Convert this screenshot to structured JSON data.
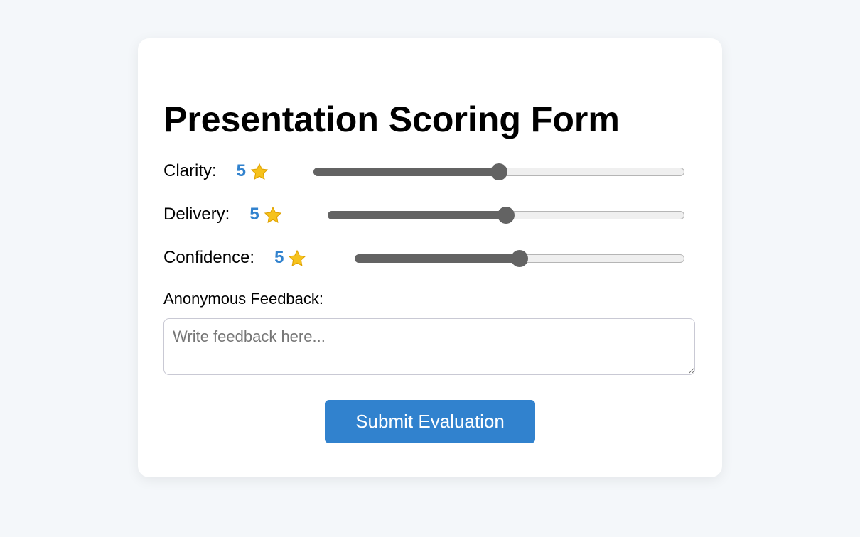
{
  "form": {
    "title": "Presentation Scoring Form",
    "criteria": [
      {
        "label": "Clarity:",
        "score": "5",
        "icon": "star-icon",
        "value": 5,
        "min": 0,
        "max": 10
      },
      {
        "label": "Delivery:",
        "score": "5",
        "icon": "star-icon",
        "value": 5,
        "min": 0,
        "max": 10
      },
      {
        "label": "Confidence:",
        "score": "5",
        "icon": "star-icon",
        "value": 5,
        "min": 0,
        "max": 10
      }
    ],
    "feedback": {
      "label": "Anonymous Feedback:",
      "placeholder": "Write feedback here...",
      "value": ""
    },
    "submit_label": "Submit Evaluation"
  },
  "colors": {
    "accent": "#3182ce",
    "background": "#f4f7fa",
    "slider_fill": "#636363",
    "star": "#f6c21c"
  }
}
